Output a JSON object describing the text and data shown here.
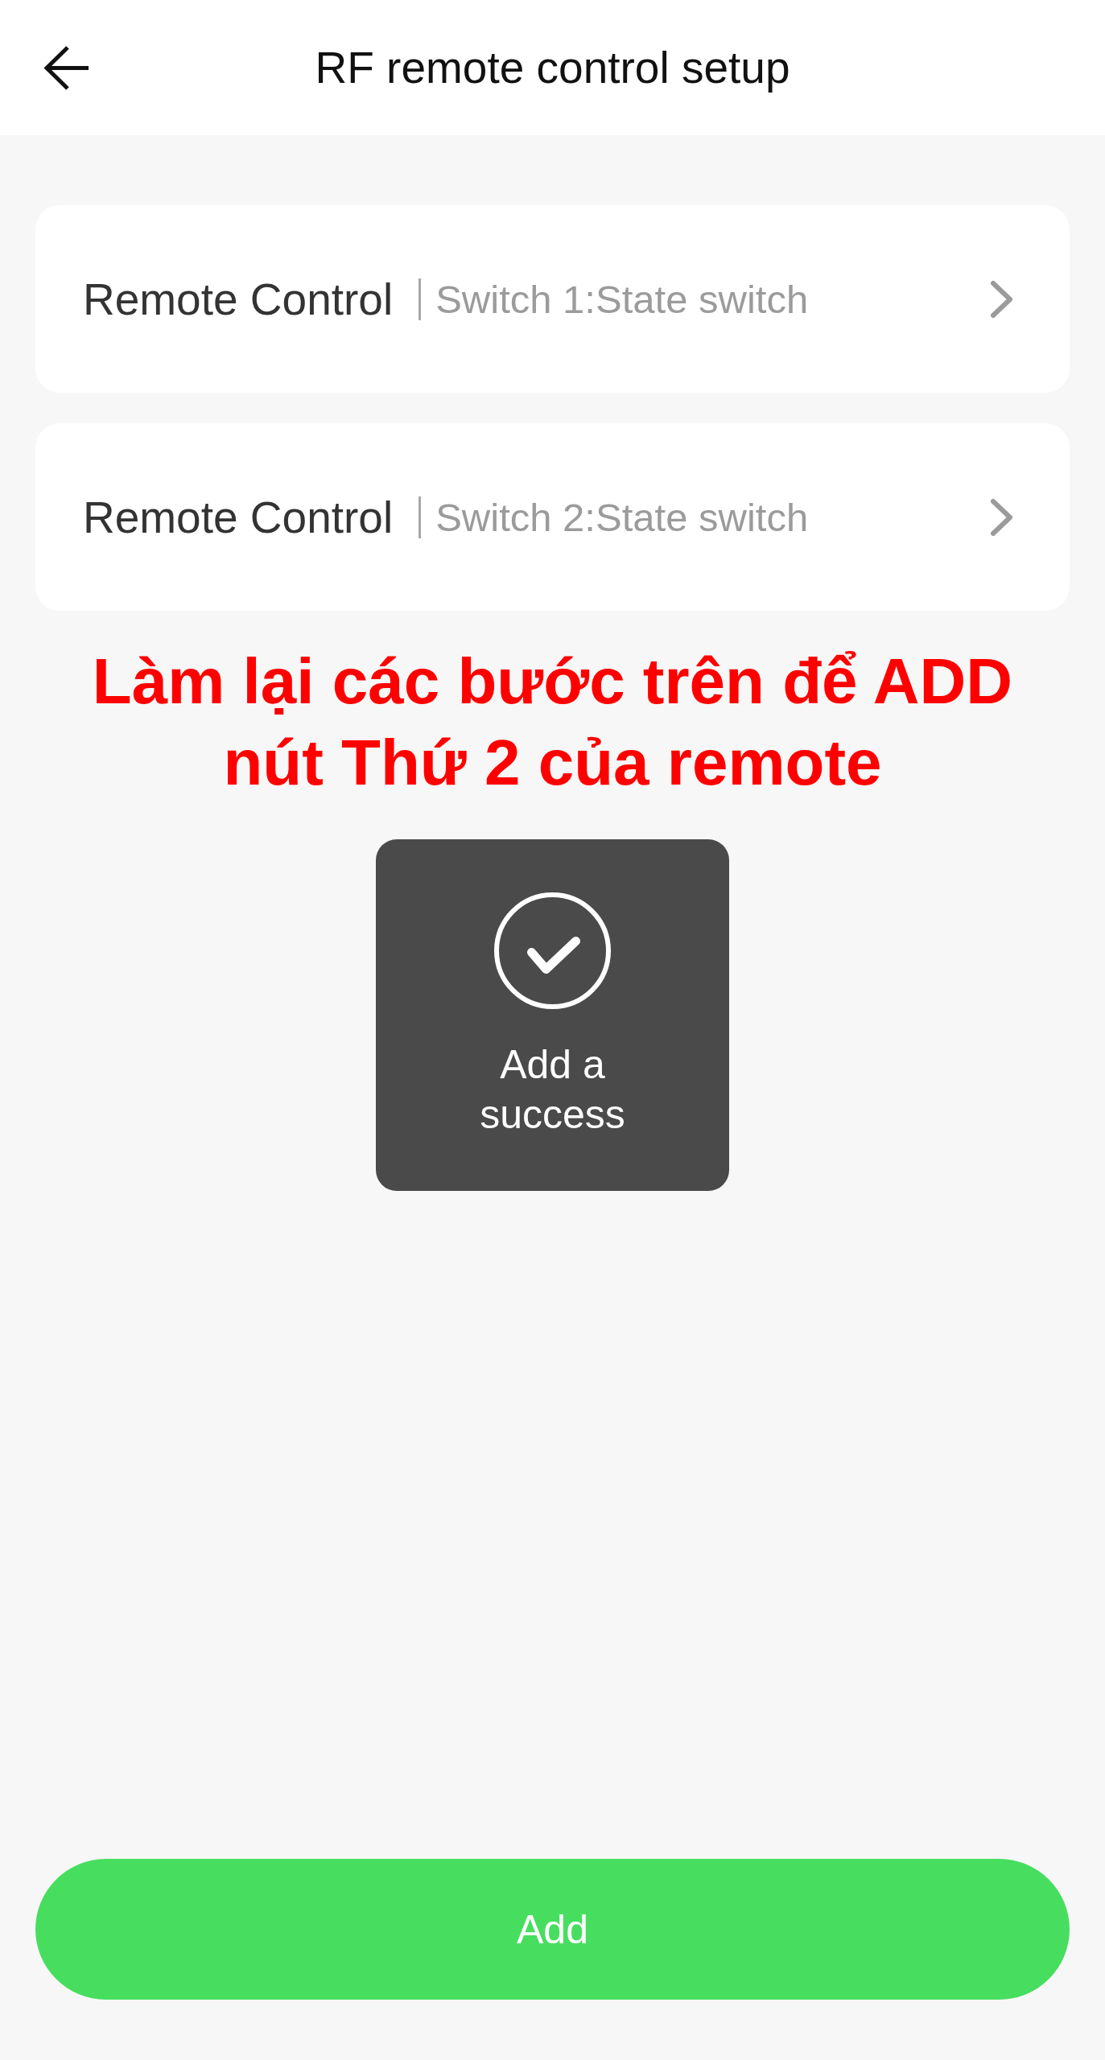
{
  "header": {
    "title": "RF remote control setup"
  },
  "remotes": [
    {
      "name": "Remote Control",
      "detail": "Switch 1:State switch"
    },
    {
      "name": "Remote Control",
      "detail": "Switch 2:State switch"
    }
  ],
  "instruction": "Làm lại các bước trên để ADD nút Thứ 2 của remote",
  "toast": {
    "message": "Add a success"
  },
  "add_button": {
    "label": "Add"
  }
}
